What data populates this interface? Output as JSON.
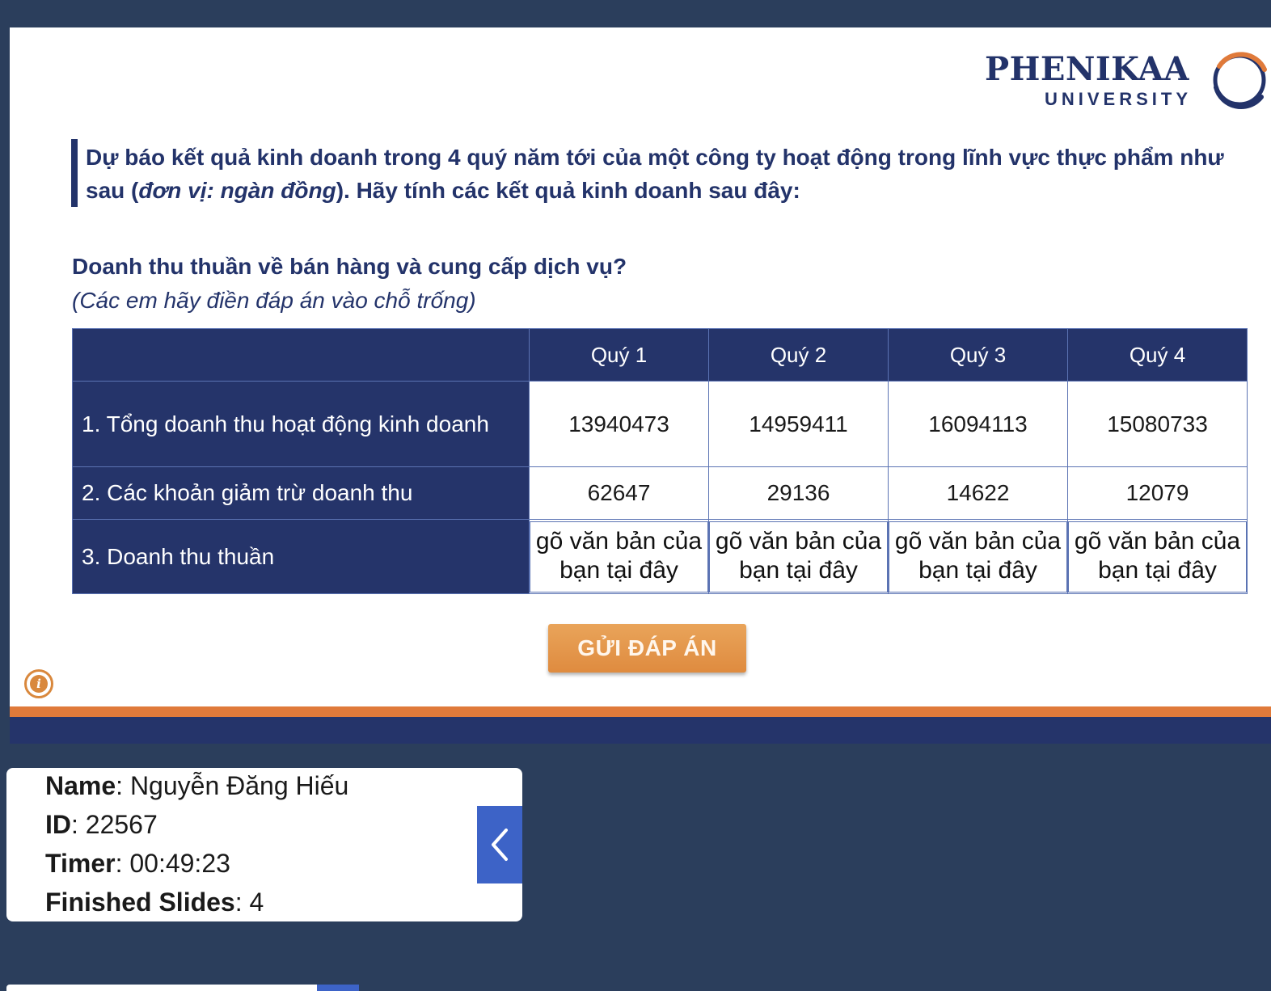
{
  "logo": {
    "name": "PHENIKAA",
    "subtitle": "UNIVERSITY"
  },
  "intro": {
    "text_before": "Dự báo kết quả kinh doanh trong 4 quý năm tới của một công ty hoạt động trong lĩnh vực thực phẩm như sau (",
    "text_italic": "đơn vị: ngàn đồng",
    "text_after": "). Hãy tính các kết quả kinh doanh sau đây:"
  },
  "question": {
    "title": "Doanh thu thuần về bán hàng và cung cấp dịch vụ?",
    "hint": "(Các em hãy điền đáp án vào chỗ trống)"
  },
  "table": {
    "headers": [
      "Quý 1",
      "Quý 2",
      "Quý 3",
      "Quý 4"
    ],
    "rows": [
      {
        "label": "1. Tổng doanh thu hoạt động kinh doanh",
        "values": [
          "13940473",
          "14959411",
          "16094113",
          "15080733"
        ]
      },
      {
        "label": "2. Các khoản giảm trừ doanh thu",
        "values": [
          "62647",
          "29136",
          "14622",
          "12079"
        ]
      },
      {
        "label": "3. Doanh thu thuần",
        "placeholders": [
          "gõ văn bản của bạn tại đây",
          "gõ văn bản của bạn tại đây",
          "gõ văn bản của bạn tại đây",
          "gõ văn bản của bạn tại đây"
        ]
      }
    ]
  },
  "submit_label": "GỬI ĐÁP ÁN",
  "info_icon": "info-icon",
  "student": {
    "name_label": "Name",
    "name_value": "Nguyễn Đăng Hiếu",
    "id_label": "ID",
    "id_value": "22567",
    "timer_label": "Timer",
    "timer_value": "00:49:23",
    "finished_label": "Finished Slides",
    "finished_value": "4"
  },
  "colors": {
    "navy": "#25346a",
    "orange": "#e07a3a",
    "background": "#2b3e5c",
    "panel_button": "#3d63c7"
  }
}
